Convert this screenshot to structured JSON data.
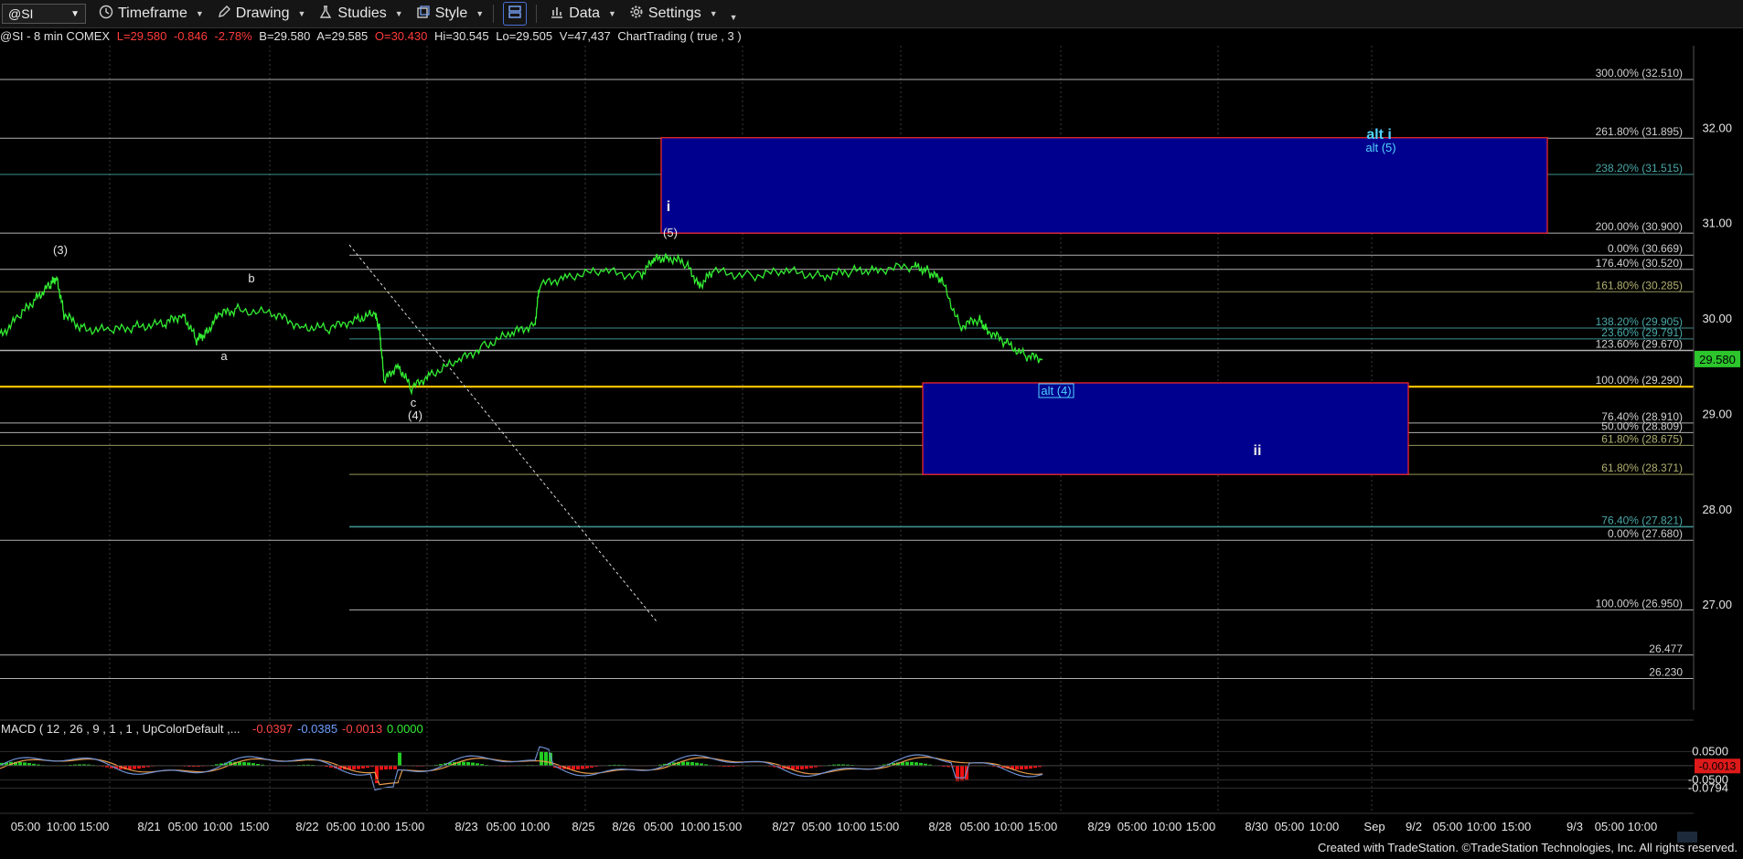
{
  "toolbar": {
    "symbol": "@SI",
    "timeframe": "Timeframe",
    "drawing": "Drawing",
    "studies": "Studies",
    "style": "Style",
    "data": "Data",
    "settings": "Settings"
  },
  "infobar": {
    "name": "@SI - 8 min  COMEX",
    "last": "L=29.580",
    "change": "-0.846",
    "pct": "-2.78%",
    "bid": "B=29.580",
    "ask": "A=29.585",
    "open": "O=30.430",
    "high": "Hi=30.545",
    "low": "Lo=29.505",
    "volume": "V=47,437",
    "extra": "ChartTrading ( true , 3 )"
  },
  "footer": "Created with TradeStation. ©TradeStation Technologies, Inc. All rights reserved.",
  "colors": {
    "price": "#33ee33",
    "box": "#00008e",
    "box_border": "#ff2a2a",
    "yellow_line": "#ffc000",
    "fib_olive": "#b0b070",
    "fib_teal": "#4aa8a8",
    "macd_line": "#6f8fd0",
    "signal_line": "#e89a4a",
    "hist_pos": "#22cc22",
    "hist_neg": "#ee1111"
  },
  "chart_data": {
    "type": "line",
    "symbol": "@SI",
    "interval": "8 min",
    "ylim": [
      25.9,
      32.75
    ],
    "y_ticks": [
      "32.00",
      "31.00",
      "30.00",
      "29.00",
      "28.00",
      "27.00"
    ],
    "last_price": "29.580",
    "x_labels": [
      "05:00",
      "10:00",
      "15:00",
      "8/21",
      "05:00",
      "10:00",
      "15:00",
      "8/22",
      "05:00",
      "10:00",
      "15:00",
      "8/23",
      "05:00",
      "10:00",
      "8/25",
      "8/26",
      "05:00",
      "10:00",
      "15:00",
      "8/27",
      "05:00",
      "10:00",
      "15:00",
      "8/28",
      "05:00",
      "10:00",
      "15:00",
      "8/29",
      "05:00",
      "10:00",
      "15:00",
      "8/30",
      "05:00",
      "10:00",
      "Sep",
      "9/2",
      "05:00",
      "10:00",
      "15:00",
      "9/3",
      "05:00",
      "10:00"
    ],
    "price_series": [
      [
        0,
        29.82
      ],
      [
        0.02,
        30.02
      ],
      [
        0.04,
        30.22
      ],
      [
        0.055,
        30.36
      ],
      [
        0.062,
        30.44
      ],
      [
        0.07,
        30.05
      ],
      [
        0.09,
        29.9
      ],
      [
        0.12,
        29.88
      ],
      [
        0.15,
        29.92
      ],
      [
        0.18,
        29.95
      ],
      [
        0.2,
        30.05
      ],
      [
        0.215,
        29.78
      ],
      [
        0.225,
        29.85
      ],
      [
        0.24,
        30.05
      ],
      [
        0.26,
        30.1
      ],
      [
        0.3,
        30.05
      ],
      [
        0.33,
        29.92
      ],
      [
        0.36,
        29.9
      ],
      [
        0.39,
        30.0
      ],
      [
        0.41,
        30.05
      ],
      [
        0.415,
        29.9
      ],
      [
        0.42,
        29.35
      ],
      [
        0.435,
        29.52
      ],
      [
        0.45,
        29.27
      ],
      [
        0.47,
        29.42
      ],
      [
        0.5,
        29.55
      ],
      [
        0.53,
        29.72
      ],
      [
        0.56,
        29.85
      ],
      [
        0.585,
        29.95
      ],
      [
        0.59,
        30.35
      ],
      [
        0.62,
        30.45
      ],
      [
        0.66,
        30.5
      ],
      [
        0.7,
        30.45
      ],
      [
        0.715,
        30.62
      ],
      [
        0.73,
        30.65
      ],
      [
        0.75,
        30.58
      ],
      [
        0.765,
        30.35
      ],
      [
        0.78,
        30.5
      ],
      [
        0.82,
        30.45
      ],
      [
        0.86,
        30.5
      ],
      [
        0.9,
        30.45
      ],
      [
        0.93,
        30.5
      ],
      [
        0.96,
        30.52
      ],
      [
        1.0,
        30.55
      ],
      [
        1.015,
        30.5
      ],
      [
        1.03,
        30.4
      ],
      [
        1.05,
        29.92
      ],
      [
        1.07,
        30.0
      ],
      [
        1.08,
        29.88
      ],
      [
        1.1,
        29.75
      ],
      [
        1.12,
        29.62
      ],
      [
        1.14,
        29.58
      ]
    ],
    "wave_labels": [
      "(3)",
      "b",
      "a",
      "c",
      "(4)",
      "(5)",
      "i",
      "alt i",
      "alt (5)",
      "alt (4)",
      "ii"
    ],
    "fib_levels": [
      {
        "label": "300.00% (32.510)",
        "value": 32.51
      },
      {
        "label": "261.80% (31.895)",
        "value": 31.895
      },
      {
        "label": "238.20% (31.515)",
        "value": 31.515
      },
      {
        "label": "200.00% (30.900)",
        "value": 30.9
      },
      {
        "label": "0.00% (30.669)",
        "value": 30.669
      },
      {
        "label": "176.40% (30.520)",
        "value": 30.52
      },
      {
        "label": "161.80% (30.285)",
        "value": 30.285
      },
      {
        "label": "138.20% (29.905)",
        "value": 29.905
      },
      {
        "label": "23.60% (29.791)",
        "value": 29.791
      },
      {
        "label": "123.60% (29.670)",
        "value": 29.67
      },
      {
        "label": "100.00% (29.290)",
        "value": 29.29
      },
      {
        "label": "76.40% (28.910)",
        "value": 28.91
      },
      {
        "label": "50.00% (28.809)",
        "value": 28.809
      },
      {
        "label": "61.80% (28.675)",
        "value": 28.675
      },
      {
        "label": "61.80% (28.371)",
        "value": 28.371
      },
      {
        "label": "76.40% (27.821)",
        "value": 27.821
      },
      {
        "label": "0.00% (27.680)",
        "value": 27.68
      },
      {
        "label": "100.00% (26.950)",
        "value": 26.95
      },
      {
        "label": "26.477",
        "value": 26.477
      },
      {
        "label": "26.230",
        "value": 26.23
      }
    ],
    "target_boxes": [
      {
        "name": "alt i",
        "top": 31.9,
        "bottom": 30.9
      },
      {
        "name": "ii",
        "top": 29.33,
        "bottom": 28.37
      }
    ],
    "macd": {
      "label": "MACD ( 12 , 26 , 9 , 1 , 1 , UpColorDefault ,...",
      "macd": "-0.0397",
      "signal": "-0.0385",
      "diff": "-0.0013",
      "zero": "0.0000",
      "y_ticks": [
        "0.0500",
        "-0.0500",
        "-0.0794"
      ],
      "last_diff": "-0.0013",
      "ylim": [
        -0.12,
        0.09
      ]
    }
  }
}
